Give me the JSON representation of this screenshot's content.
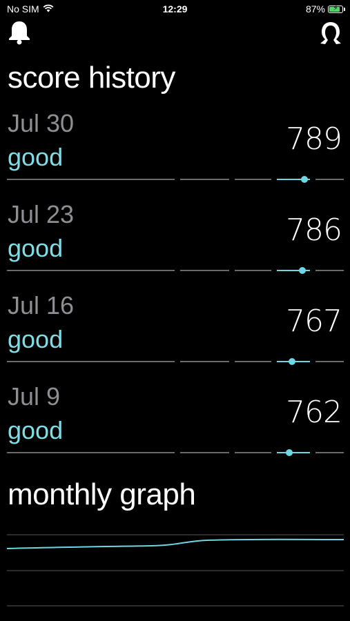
{
  "status_bar": {
    "carrier": "No SIM",
    "time": "12:29",
    "battery_percent": "87%",
    "battery_level": 0.87,
    "charging": true,
    "icons": [
      "wifi-icon",
      "battery-icon",
      "charging-bolt-icon"
    ]
  },
  "header": {
    "left_icon": "bell-icon",
    "right_icon": "profile-icon"
  },
  "score_history": {
    "title": "score history",
    "scale_min": 300,
    "scale_max": 850,
    "bands": [
      {
        "from": 300,
        "to": 580
      },
      {
        "from": 580,
        "to": 670
      },
      {
        "from": 670,
        "to": 740
      },
      {
        "from": 740,
        "to": 800
      },
      {
        "from": 800,
        "to": 850
      }
    ],
    "entries": [
      {
        "date": "Jul 30",
        "rating": "good",
        "score": "789",
        "value": 789
      },
      {
        "date": "Jul 23",
        "rating": "good",
        "score": "786",
        "value": 786
      },
      {
        "date": "Jul 16",
        "rating": "good",
        "score": "767",
        "value": 767
      },
      {
        "date": "Jul 9",
        "rating": "good",
        "score": "762",
        "value": 762
      }
    ]
  },
  "monthly_graph": {
    "title": "monthly graph",
    "line_color": "#6fd6e3",
    "grid_color": "#5a5a5a",
    "gridlines": 3
  },
  "colors": {
    "accent": "#6fd6e3",
    "rating_text": "#7fdde6",
    "date_text": "#8e8e93",
    "background": "#000000"
  }
}
